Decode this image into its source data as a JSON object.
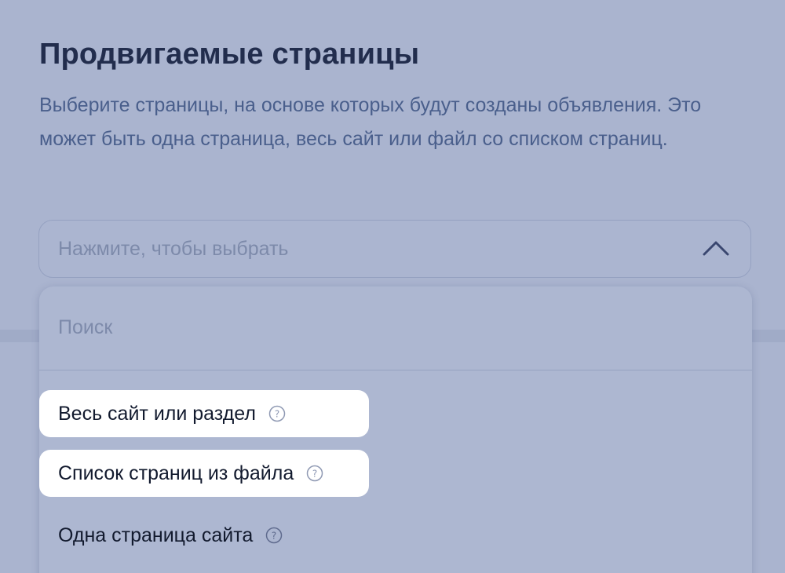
{
  "section": {
    "title": "Продвигаемые страницы",
    "description": "Выберите страницы, на основе которых будут созданы объявления. Это может быть одна страница, весь сайт или файл со списком страниц."
  },
  "select": {
    "placeholder": "Нажмите, чтобы выбрать",
    "expanded": true,
    "icon": "chevron-up-icon"
  },
  "dropdown": {
    "search_placeholder": "Поиск",
    "options": [
      {
        "label": "Весь сайт или раздел",
        "icon": "help-icon",
        "highlighted": true
      },
      {
        "label": "Список страниц из файла",
        "icon": "help-icon",
        "highlighted": true
      },
      {
        "label": "Одна страница сайта",
        "icon": "help-icon",
        "highlighted": false
      }
    ]
  },
  "colors": {
    "background": "#aab4cf",
    "title": "#222d4d",
    "description": "#4a5f8c",
    "placeholder": "#7d8aaa",
    "highlight": "#ffffff"
  }
}
